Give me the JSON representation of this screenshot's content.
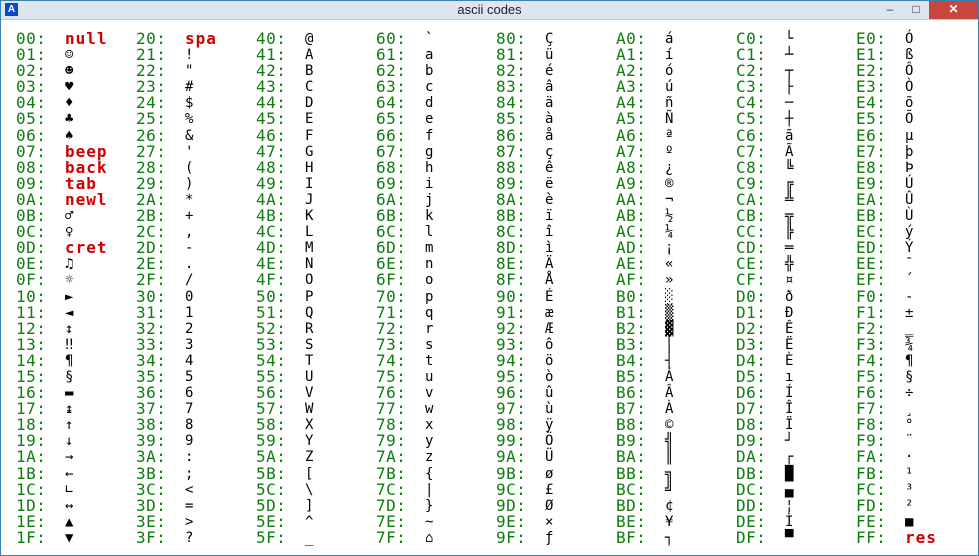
{
  "window": {
    "title": "ascii codes",
    "app_icon_label": "A",
    "minimize_label": "–",
    "maximize_label": "□",
    "close_label": "✕"
  },
  "columns": [
    [
      [
        "00:",
        "null"
      ],
      [
        "01:",
        "☺"
      ],
      [
        "02:",
        "☻"
      ],
      [
        "03:",
        "♥"
      ],
      [
        "04:",
        "♦"
      ],
      [
        "05:",
        "♣"
      ],
      [
        "06:",
        "♠"
      ],
      [
        "07:",
        "beep"
      ],
      [
        "08:",
        "back"
      ],
      [
        "09:",
        "tab"
      ],
      [
        "0A:",
        "newl"
      ],
      [
        "0B:",
        "♂"
      ],
      [
        "0C:",
        "♀"
      ],
      [
        "0D:",
        "cret"
      ],
      [
        "0E:",
        "♫"
      ],
      [
        "0F:",
        "☼"
      ],
      [
        "10:",
        "►"
      ],
      [
        "11:",
        "◄"
      ],
      [
        "12:",
        "↕"
      ],
      [
        "13:",
        "‼"
      ],
      [
        "14:",
        "¶"
      ],
      [
        "15:",
        "§"
      ],
      [
        "16:",
        "▬"
      ],
      [
        "17:",
        "↨"
      ],
      [
        "18:",
        "↑"
      ],
      [
        "19:",
        "↓"
      ],
      [
        "1A:",
        "→"
      ],
      [
        "1B:",
        "←"
      ],
      [
        "1C:",
        "∟"
      ],
      [
        "1D:",
        "↔"
      ],
      [
        "1E:",
        "▲"
      ],
      [
        "1F:",
        "▼"
      ]
    ],
    [
      [
        "20:",
        "spa"
      ],
      [
        "21:",
        "!"
      ],
      [
        "22:",
        "\""
      ],
      [
        "23:",
        "#"
      ],
      [
        "24:",
        "$"
      ],
      [
        "25:",
        "%"
      ],
      [
        "26:",
        "&"
      ],
      [
        "27:",
        "'"
      ],
      [
        "28:",
        "("
      ],
      [
        "29:",
        ")"
      ],
      [
        "2A:",
        "*"
      ],
      [
        "2B:",
        "+"
      ],
      [
        "2C:",
        ","
      ],
      [
        "2D:",
        "-"
      ],
      [
        "2E:",
        "."
      ],
      [
        "2F:",
        "/"
      ],
      [
        "30:",
        "0"
      ],
      [
        "31:",
        "1"
      ],
      [
        "32:",
        "2"
      ],
      [
        "33:",
        "3"
      ],
      [
        "34:",
        "4"
      ],
      [
        "35:",
        "5"
      ],
      [
        "36:",
        "6"
      ],
      [
        "37:",
        "7"
      ],
      [
        "38:",
        "8"
      ],
      [
        "39:",
        "9"
      ],
      [
        "3A:",
        ":"
      ],
      [
        "3B:",
        ";"
      ],
      [
        "3C:",
        "<"
      ],
      [
        "3D:",
        "="
      ],
      [
        "3E:",
        ">"
      ],
      [
        "3F:",
        "?"
      ]
    ],
    [
      [
        "40:",
        "@"
      ],
      [
        "41:",
        "A"
      ],
      [
        "42:",
        "B"
      ],
      [
        "43:",
        "C"
      ],
      [
        "44:",
        "D"
      ],
      [
        "45:",
        "E"
      ],
      [
        "46:",
        "F"
      ],
      [
        "47:",
        "G"
      ],
      [
        "48:",
        "H"
      ],
      [
        "49:",
        "I"
      ],
      [
        "4A:",
        "J"
      ],
      [
        "4B:",
        "K"
      ],
      [
        "4C:",
        "L"
      ],
      [
        "4D:",
        "M"
      ],
      [
        "4E:",
        "N"
      ],
      [
        "4F:",
        "O"
      ],
      [
        "50:",
        "P"
      ],
      [
        "51:",
        "Q"
      ],
      [
        "52:",
        "R"
      ],
      [
        "53:",
        "S"
      ],
      [
        "54:",
        "T"
      ],
      [
        "55:",
        "U"
      ],
      [
        "56:",
        "V"
      ],
      [
        "57:",
        "W"
      ],
      [
        "58:",
        "X"
      ],
      [
        "59:",
        "Y"
      ],
      [
        "5A:",
        "Z"
      ],
      [
        "5B:",
        "["
      ],
      [
        "5C:",
        "\\"
      ],
      [
        "5D:",
        "]"
      ],
      [
        "5E:",
        "^"
      ],
      [
        "5F:",
        "_"
      ]
    ],
    [
      [
        "60:",
        "`"
      ],
      [
        "61:",
        "a"
      ],
      [
        "62:",
        "b"
      ],
      [
        "63:",
        "c"
      ],
      [
        "64:",
        "d"
      ],
      [
        "65:",
        "e"
      ],
      [
        "66:",
        "f"
      ],
      [
        "67:",
        "g"
      ],
      [
        "68:",
        "h"
      ],
      [
        "69:",
        "i"
      ],
      [
        "6A:",
        "j"
      ],
      [
        "6B:",
        "k"
      ],
      [
        "6C:",
        "l"
      ],
      [
        "6D:",
        "m"
      ],
      [
        "6E:",
        "n"
      ],
      [
        "6F:",
        "o"
      ],
      [
        "70:",
        "p"
      ],
      [
        "71:",
        "q"
      ],
      [
        "72:",
        "r"
      ],
      [
        "73:",
        "s"
      ],
      [
        "74:",
        "t"
      ],
      [
        "75:",
        "u"
      ],
      [
        "76:",
        "v"
      ],
      [
        "77:",
        "w"
      ],
      [
        "78:",
        "x"
      ],
      [
        "79:",
        "y"
      ],
      [
        "7A:",
        "z"
      ],
      [
        "7B:",
        "{"
      ],
      [
        "7C:",
        "|"
      ],
      [
        "7D:",
        "}"
      ],
      [
        "7E:",
        "~"
      ],
      [
        "7F:",
        "⌂"
      ]
    ],
    [
      [
        "80:",
        "Ç"
      ],
      [
        "81:",
        "ü"
      ],
      [
        "82:",
        "é"
      ],
      [
        "83:",
        "â"
      ],
      [
        "84:",
        "ä"
      ],
      [
        "85:",
        "à"
      ],
      [
        "86:",
        "å"
      ],
      [
        "87:",
        "ç"
      ],
      [
        "88:",
        "ê"
      ],
      [
        "89:",
        "ë"
      ],
      [
        "8A:",
        "è"
      ],
      [
        "8B:",
        "ï"
      ],
      [
        "8C:",
        "î"
      ],
      [
        "8D:",
        "ì"
      ],
      [
        "8E:",
        "Ä"
      ],
      [
        "8F:",
        "Å"
      ],
      [
        "90:",
        "É"
      ],
      [
        "91:",
        "æ"
      ],
      [
        "92:",
        "Æ"
      ],
      [
        "93:",
        "ô"
      ],
      [
        "94:",
        "ö"
      ],
      [
        "95:",
        "ò"
      ],
      [
        "96:",
        "û"
      ],
      [
        "97:",
        "ù"
      ],
      [
        "98:",
        "ÿ"
      ],
      [
        "99:",
        "Ö"
      ],
      [
        "9A:",
        "Ü"
      ],
      [
        "9B:",
        "ø"
      ],
      [
        "9C:",
        "£"
      ],
      [
        "9D:",
        "Ø"
      ],
      [
        "9E:",
        "×"
      ],
      [
        "9F:",
        "ƒ"
      ]
    ],
    [
      [
        "A0:",
        "á"
      ],
      [
        "A1:",
        "í"
      ],
      [
        "A2:",
        "ó"
      ],
      [
        "A3:",
        "ú"
      ],
      [
        "A4:",
        "ñ"
      ],
      [
        "A5:",
        "Ñ"
      ],
      [
        "A6:",
        "ª"
      ],
      [
        "A7:",
        "º"
      ],
      [
        "A8:",
        "¿"
      ],
      [
        "A9:",
        "®"
      ],
      [
        "AA:",
        "¬"
      ],
      [
        "AB:",
        "½"
      ],
      [
        "AC:",
        "¼"
      ],
      [
        "AD:",
        "¡"
      ],
      [
        "AE:",
        "«"
      ],
      [
        "AF:",
        "»"
      ],
      [
        "B0:",
        "░"
      ],
      [
        "B1:",
        "▒"
      ],
      [
        "B2:",
        "▓"
      ],
      [
        "B3:",
        "│"
      ],
      [
        "B4:",
        "┤"
      ],
      [
        "B5:",
        "Á"
      ],
      [
        "B6:",
        "Â"
      ],
      [
        "B7:",
        "À"
      ],
      [
        "B8:",
        "©"
      ],
      [
        "B9:",
        "╣"
      ],
      [
        "BA:",
        "║"
      ],
      [
        "BB:",
        "╗"
      ],
      [
        "BC:",
        "╝"
      ],
      [
        "BD:",
        "¢"
      ],
      [
        "BE:",
        "¥"
      ],
      [
        "BF:",
        "┐"
      ]
    ],
    [
      [
        "C0:",
        "└"
      ],
      [
        "C1:",
        "┴"
      ],
      [
        "C2:",
        "┬"
      ],
      [
        "C3:",
        "├"
      ],
      [
        "C4:",
        "─"
      ],
      [
        "C5:",
        "┼"
      ],
      [
        "C6:",
        "ã"
      ],
      [
        "C7:",
        "Ã"
      ],
      [
        "C8:",
        "╚"
      ],
      [
        "C9:",
        "╔"
      ],
      [
        "CA:",
        "╩"
      ],
      [
        "CB:",
        "╦"
      ],
      [
        "CC:",
        "╠"
      ],
      [
        "CD:",
        "═"
      ],
      [
        "CE:",
        "╬"
      ],
      [
        "CF:",
        "¤"
      ],
      [
        "D0:",
        "ð"
      ],
      [
        "D1:",
        "Ð"
      ],
      [
        "D2:",
        "Ê"
      ],
      [
        "D3:",
        "Ë"
      ],
      [
        "D4:",
        "È"
      ],
      [
        "D5:",
        "ı"
      ],
      [
        "D6:",
        "Í"
      ],
      [
        "D7:",
        "Î"
      ],
      [
        "D8:",
        "Ï"
      ],
      [
        "D9:",
        "┘"
      ],
      [
        "DA:",
        "┌"
      ],
      [
        "DB:",
        "█"
      ],
      [
        "DC:",
        "▄"
      ],
      [
        "DD:",
        "¦"
      ],
      [
        "DE:",
        "Ì"
      ],
      [
        "DF:",
        "▀"
      ]
    ],
    [
      [
        "E0:",
        "Ó"
      ],
      [
        "E1:",
        "ß"
      ],
      [
        "E2:",
        "Ô"
      ],
      [
        "E3:",
        "Ò"
      ],
      [
        "E4:",
        "õ"
      ],
      [
        "E5:",
        "Õ"
      ],
      [
        "E6:",
        "µ"
      ],
      [
        "E7:",
        "þ"
      ],
      [
        "E8:",
        "Þ"
      ],
      [
        "E9:",
        "Ú"
      ],
      [
        "EA:",
        "Û"
      ],
      [
        "EB:",
        "Ù"
      ],
      [
        "EC:",
        "ý"
      ],
      [
        "ED:",
        "Ý"
      ],
      [
        "EE:",
        "¯"
      ],
      [
        "EF:",
        "´"
      ],
      [
        "F0:",
        "-"
      ],
      [
        "F1:",
        "±"
      ],
      [
        "F2:",
        "‗"
      ],
      [
        "F3:",
        "¾"
      ],
      [
        "F4:",
        "¶"
      ],
      [
        "F5:",
        "§"
      ],
      [
        "F6:",
        "÷"
      ],
      [
        "F7:",
        "¸"
      ],
      [
        "F8:",
        "°"
      ],
      [
        "F9:",
        "¨"
      ],
      [
        "FA:",
        "·"
      ],
      [
        "FB:",
        "¹"
      ],
      [
        "FC:",
        "³"
      ],
      [
        "FD:",
        "²"
      ],
      [
        "FE:",
        "■"
      ],
      [
        "FF:",
        "res"
      ]
    ]
  ],
  "named_glyphs": [
    "null",
    "beep",
    "back",
    "tab",
    "newl",
    "cret",
    "spa",
    "res"
  ],
  "colors": {
    "code": "#0e7d0e",
    "glyph": "#000000",
    "named": "#d10000",
    "close": "#c7463d"
  }
}
